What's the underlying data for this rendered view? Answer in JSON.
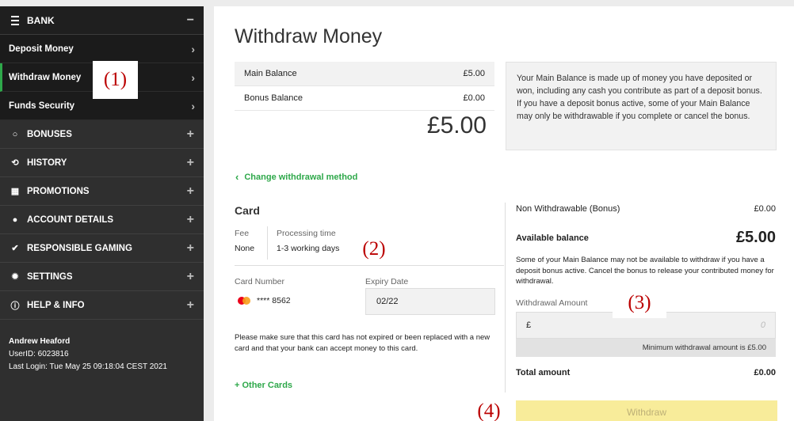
{
  "sidebar": {
    "bank": {
      "label": "BANK",
      "toggle": "−"
    },
    "subitems": [
      {
        "label": "Deposit Money",
        "chevron": "›"
      },
      {
        "label": "Withdraw Money",
        "chevron": "›"
      },
      {
        "label": "Funds Security",
        "chevron": "›"
      }
    ],
    "items": [
      {
        "label": "BONUSES",
        "icon": "○"
      },
      {
        "label": "HISTORY",
        "icon": "⟲"
      },
      {
        "label": "PROMOTIONS",
        "icon": "▦"
      },
      {
        "label": "ACCOUNT DETAILS",
        "icon": "●"
      },
      {
        "label": "RESPONSIBLE GAMING",
        "icon": "✔"
      },
      {
        "label": "SETTINGS",
        "icon": "✹"
      },
      {
        "label": "HELP & INFO",
        "icon": "ⓘ"
      }
    ],
    "expand_symbol": "+",
    "user": {
      "name": "Andrew Heaford",
      "user_id": "UserID: 6023816",
      "last_login": "Last Login: Tue May 25 09:18:04 CEST 2021"
    }
  },
  "callouts": {
    "one": "(1)",
    "two": "(2)",
    "three": "(3)",
    "four": "(4)"
  },
  "main": {
    "title": "Withdraw Money",
    "balances": [
      {
        "label": "Main Balance",
        "value": "£5.00"
      },
      {
        "label": "Bonus Balance",
        "value": "£0.00"
      }
    ],
    "total": "£5.00",
    "info_text": "Your Main Balance is made up of money you have deposited or won, including any cash you contribute as part of a deposit bonus. If you have a deposit bonus active, some of your Main Balance may only be withdrawable if you complete or cancel the bonus.",
    "change_method": {
      "chevron": "‹",
      "label": "Change withdrawal method"
    },
    "card": {
      "title": "Card",
      "fee_label": "Fee",
      "fee_value": "None",
      "processing_label": "Processing time",
      "processing_value": "1-3 working days",
      "number_label": "Card Number",
      "number_value": "**** 8562",
      "expiry_label": "Expiry Date",
      "expiry_value": "02/22",
      "notice": "Please make sure that this card has not expired or been replaced with a new card and that your bank can accept money to this card.",
      "other_cards": "+ Other Cards"
    },
    "summary": {
      "non_withdrawable_label": "Non Withdrawable (Bonus)",
      "non_withdrawable_value": "£0.00",
      "available_label": "Available balance",
      "available_value": "£5.00",
      "available_note": "Some of your Main Balance may not be available to withdraw if you have a deposit bonus active. Cancel the bonus to release your contributed money for withdrawal.",
      "amount_label": "Withdrawal Amount",
      "currency": "£",
      "amount_placeholder": "0",
      "min_note": "Minimum withdrawal amount is £5.00",
      "total_label": "Total amount",
      "total_value": "£0.00",
      "withdraw_button": "Withdraw"
    }
  },
  "colors": {
    "accent": "#2ea84a",
    "sidebar": "#2f2f2f",
    "button": "#f8ec9a"
  }
}
